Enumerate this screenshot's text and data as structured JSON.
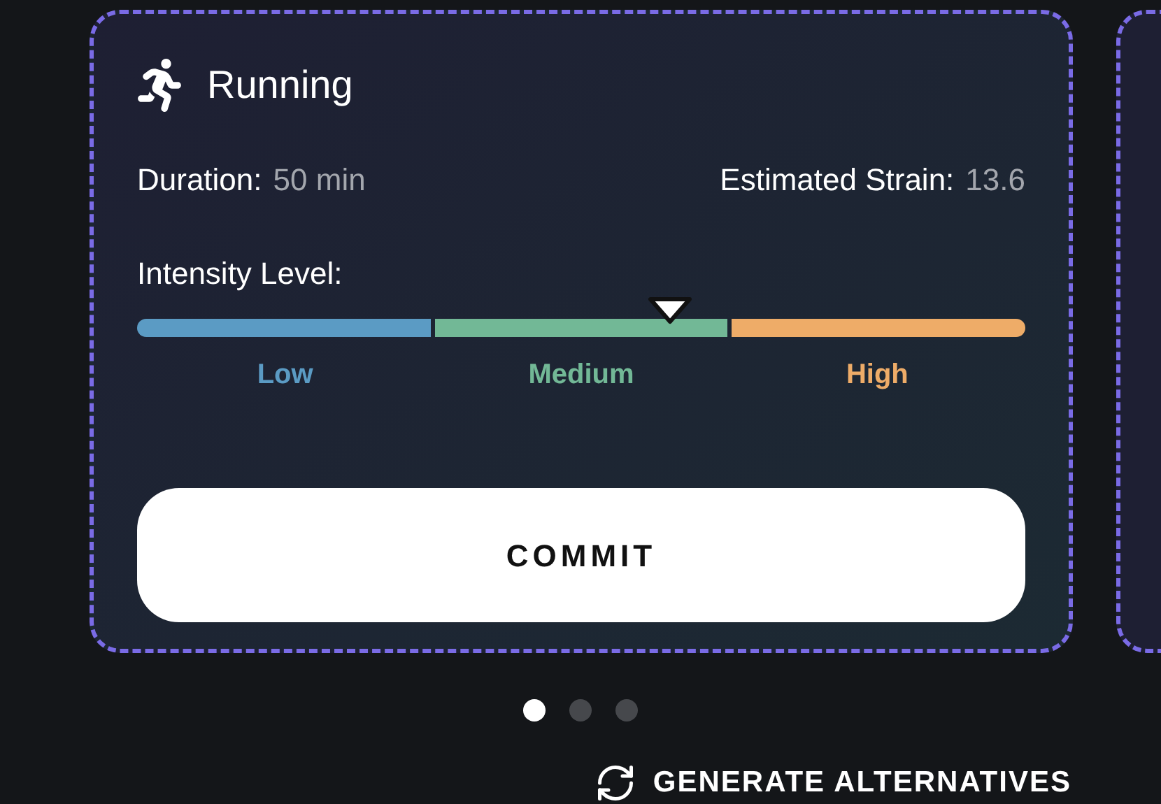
{
  "card": {
    "title": "Running",
    "duration": {
      "label": "Duration:",
      "value": "50 min"
    },
    "strain": {
      "label": "Estimated Strain:",
      "value": "13.6"
    },
    "intensity": {
      "label": "Intensity Level:",
      "level": 0.6,
      "segments": [
        {
          "label": "Low",
          "color": "#5b9bc4"
        },
        {
          "label": "Medium",
          "color": "#72b896"
        },
        {
          "label": "High",
          "color": "#eeac68"
        }
      ]
    },
    "button": "COMMIT"
  },
  "pages": [
    {
      "selected": true
    },
    {
      "selected": false
    },
    {
      "selected": false
    }
  ],
  "generate_button": "GENERATE ALTERNATIVES"
}
